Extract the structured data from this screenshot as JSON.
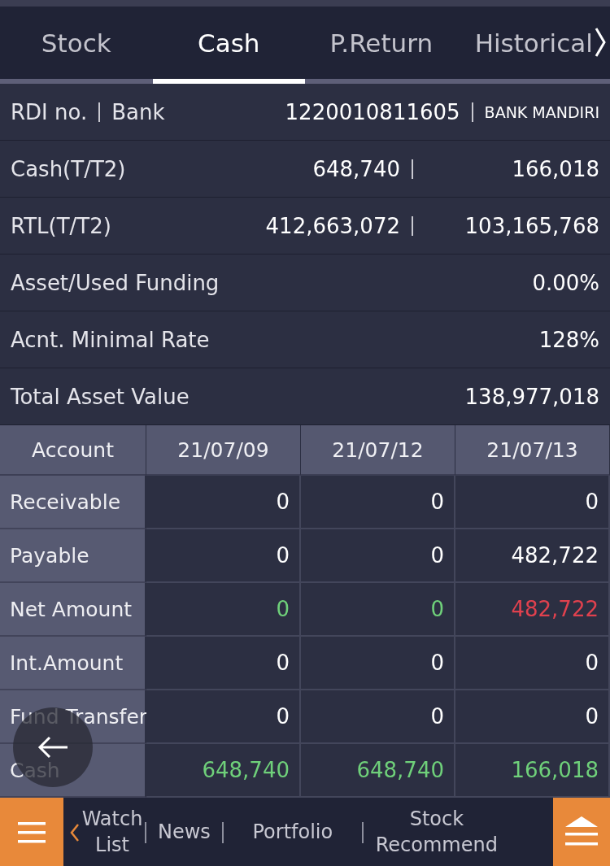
{
  "tabs": [
    {
      "label": "Stock",
      "selected": false
    },
    {
      "label": "Cash",
      "selected": true
    },
    {
      "label": "P.Return",
      "selected": false
    },
    {
      "label": "Historical",
      "selected": false
    }
  ],
  "info_rows": [
    {
      "kind": "account",
      "labels": [
        "RDI no.",
        "Bank"
      ],
      "values": [
        "1220010811605",
        "BANK MANDIRI"
      ]
    },
    {
      "kind": "pair",
      "labels": [
        "Cash(T/T2)"
      ],
      "values": [
        "648,740",
        "166,018"
      ]
    },
    {
      "kind": "pair",
      "labels": [
        "RTL(T/T2)"
      ],
      "values": [
        "412,663,072",
        "103,165,768"
      ]
    },
    {
      "kind": "single",
      "labels": [
        "Asset/Used Funding"
      ],
      "values": [
        "0.00%"
      ]
    },
    {
      "kind": "single",
      "labels": [
        "Acnt. Minimal Rate"
      ],
      "values": [
        "128%"
      ]
    },
    {
      "kind": "single",
      "labels": [
        "Total Asset Value"
      ],
      "values": [
        "138,977,018"
      ]
    }
  ],
  "table": {
    "columns": [
      "Account",
      "21/07/09",
      "21/07/12",
      "21/07/13"
    ],
    "rows": [
      {
        "label": "Receivable",
        "cells": [
          {
            "text": "0",
            "color": "#ffffff"
          },
          {
            "text": "0",
            "color": "#ffffff"
          },
          {
            "text": "0",
            "color": "#ffffff"
          }
        ]
      },
      {
        "label": "Payable",
        "cells": [
          {
            "text": "0",
            "color": "#ffffff"
          },
          {
            "text": "0",
            "color": "#ffffff"
          },
          {
            "text": "482,722",
            "color": "#ffffff"
          }
        ]
      },
      {
        "label": "Net Amount",
        "cells": [
          {
            "text": "0",
            "color": "#6fd07a"
          },
          {
            "text": "0",
            "color": "#6fd07a"
          },
          {
            "text": "482,722",
            "color": "#e0414e"
          }
        ]
      },
      {
        "label": "Int.Amount",
        "cells": [
          {
            "text": "0",
            "color": "#ffffff"
          },
          {
            "text": "0",
            "color": "#ffffff"
          },
          {
            "text": "0",
            "color": "#ffffff"
          }
        ]
      },
      {
        "label": "Fund Transfer",
        "cells": [
          {
            "text": "0",
            "color": "#ffffff"
          },
          {
            "text": "0",
            "color": "#ffffff"
          },
          {
            "text": "0",
            "color": "#ffffff"
          }
        ]
      },
      {
        "label": "Cash",
        "cells": [
          {
            "text": "648,740",
            "color": "#6fd07a"
          },
          {
            "text": "648,740",
            "color": "#6fd07a"
          },
          {
            "text": "166,018",
            "color": "#6fd07a"
          }
        ]
      }
    ]
  },
  "bottom_nav": {
    "items": [
      "Watch List",
      "News",
      "Portfolio",
      "Stock Recommend"
    ]
  }
}
